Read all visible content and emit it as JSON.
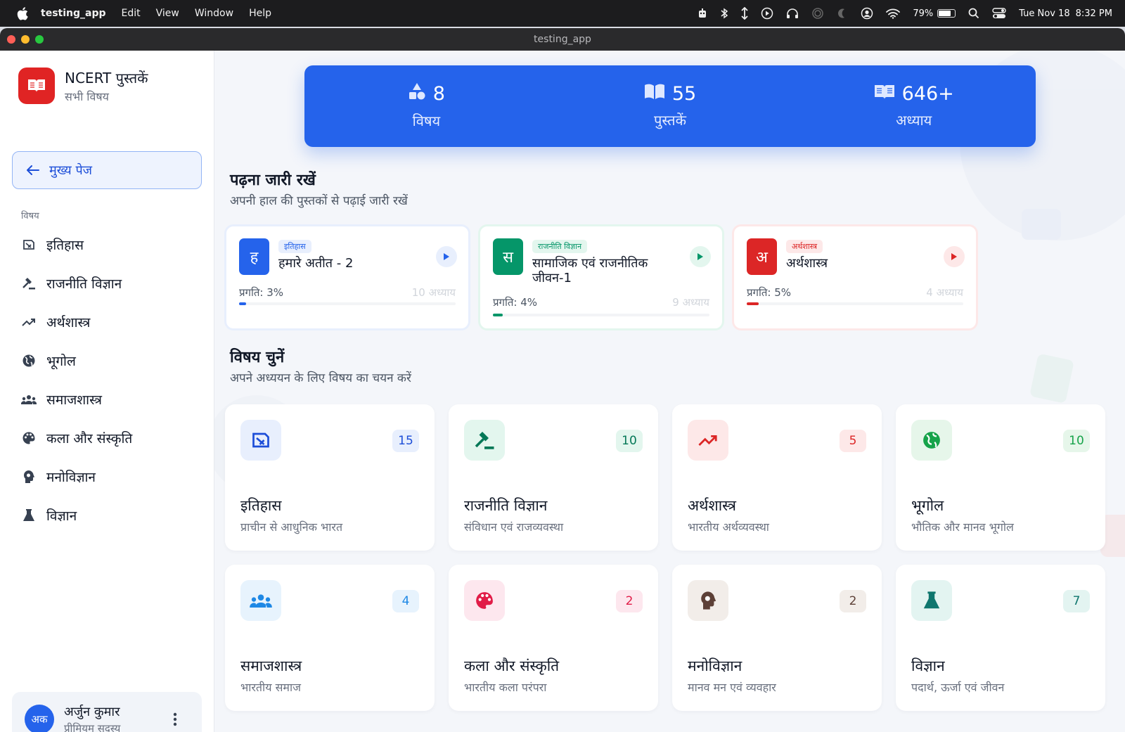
{
  "menubar": {
    "app_name": "testing_app",
    "items": [
      "Edit",
      "View",
      "Window",
      "Help"
    ],
    "battery": "79%",
    "battery_level": 0.79,
    "date": "Tue Nov 18",
    "time": "8:32 PM"
  },
  "window": {
    "title": "testing_app"
  },
  "sidebar": {
    "brand_title": "NCERT पुस्तकें",
    "brand_subtitle": "सभी विषय",
    "home_button": "मुख्य पेज",
    "section_label": "विषय",
    "items": [
      {
        "label": "इतिहास",
        "icon": "history-icon"
      },
      {
        "label": "राजनीति विज्ञान",
        "icon": "gavel-icon"
      },
      {
        "label": "अर्थशास्त्र",
        "icon": "trending-up-icon"
      },
      {
        "label": "भूगोल",
        "icon": "globe-icon"
      },
      {
        "label": "समाजशास्त्र",
        "icon": "people-icon"
      },
      {
        "label": "कला और संस्कृति",
        "icon": "palette-icon"
      },
      {
        "label": "मनोविज्ञान",
        "icon": "brain-icon"
      },
      {
        "label": "विज्ञान",
        "icon": "flask-icon"
      }
    ],
    "user": {
      "initials": "अक",
      "name": "अर्जुन कुमार",
      "role": "प्रीमियम सदस्य"
    }
  },
  "stats": [
    {
      "value": "8",
      "label": "विषय",
      "icon": "shapes-icon"
    },
    {
      "value": "55",
      "label": "पुस्तकें",
      "icon": "open-book-icon"
    },
    {
      "value": "646+",
      "label": "अध्याय",
      "icon": "book-icon"
    }
  ],
  "continue_reading": {
    "title": "पढ़ना जारी रखें",
    "subtitle": "अपनी हाल की पुस्तकों से पढ़ाई जारी रखें",
    "cards": [
      {
        "letter": "ह",
        "tag": "इतिहास",
        "title": "हमारे अतीत - 2",
        "progress_label": "प्रगति: 3%",
        "progress": 0.03,
        "chapters": "10 अध्याय",
        "color": "#2563eb",
        "tint": "#e8effd"
      },
      {
        "letter": "स",
        "tag": "राजनीति विज्ञान",
        "title": "सामाजिक एवं राजनीतिक जीवन-1",
        "progress_label": "प्रगति: 4%",
        "progress": 0.04,
        "chapters": "9 अध्याय",
        "color": "#059669",
        "tint": "#e3f6ee"
      },
      {
        "letter": "अ",
        "tag": "अर्थशास्त्र",
        "title": "अर्थशास्त्र",
        "progress_label": "प्रगति: 5%",
        "progress": 0.05,
        "chapters": "4 अध्याय",
        "color": "#dc2626",
        "tint": "#fde8e8"
      }
    ]
  },
  "choose_subject": {
    "title": "विषय चुनें",
    "subtitle": "अपने अध्ययन के लिए विषय का चयन करें",
    "cards": [
      {
        "name": "इतिहास",
        "desc": "प्राचीन से आधुनिक भारत",
        "count": "15",
        "icon": "history-icon",
        "color": "#1d4ed8",
        "tint": "#e8effd"
      },
      {
        "name": "राजनीति विज्ञान",
        "desc": "संविधान एवं राजव्यवस्था",
        "count": "10",
        "icon": "gavel-icon",
        "color": "#047857",
        "tint": "#e3f6ee"
      },
      {
        "name": "अर्थशास्त्र",
        "desc": "भारतीय अर्थव्यवस्था",
        "count": "5",
        "icon": "trending-up-icon",
        "color": "#dc2626",
        "tint": "#fde8e8"
      },
      {
        "name": "भूगोल",
        "desc": "भौतिक और मानव भूगोल",
        "count": "10",
        "icon": "globe-icon",
        "color": "#16a34a",
        "tint": "#e6f6ea"
      },
      {
        "name": "समाजशास्त्र",
        "desc": "भारतीय समाज",
        "count": "4",
        "icon": "people-icon",
        "color": "#1e88e5",
        "tint": "#e7f3fd"
      },
      {
        "name": "कला और संस्कृति",
        "desc": "भारतीय कला परंपरा",
        "count": "2",
        "icon": "palette-icon",
        "color": "#e11d48",
        "tint": "#fde7ee"
      },
      {
        "name": "मनोविज्ञान",
        "desc": "मानव मन एवं व्यवहार",
        "count": "2",
        "icon": "brain-icon",
        "color": "#5d4037",
        "tint": "#f2ede9"
      },
      {
        "name": "विज्ञान",
        "desc": "पदार्थ, ऊर्जा एवं जीवन",
        "count": "7",
        "icon": "flask-icon",
        "color": "#0f766e",
        "tint": "#e3f4f1"
      }
    ]
  }
}
